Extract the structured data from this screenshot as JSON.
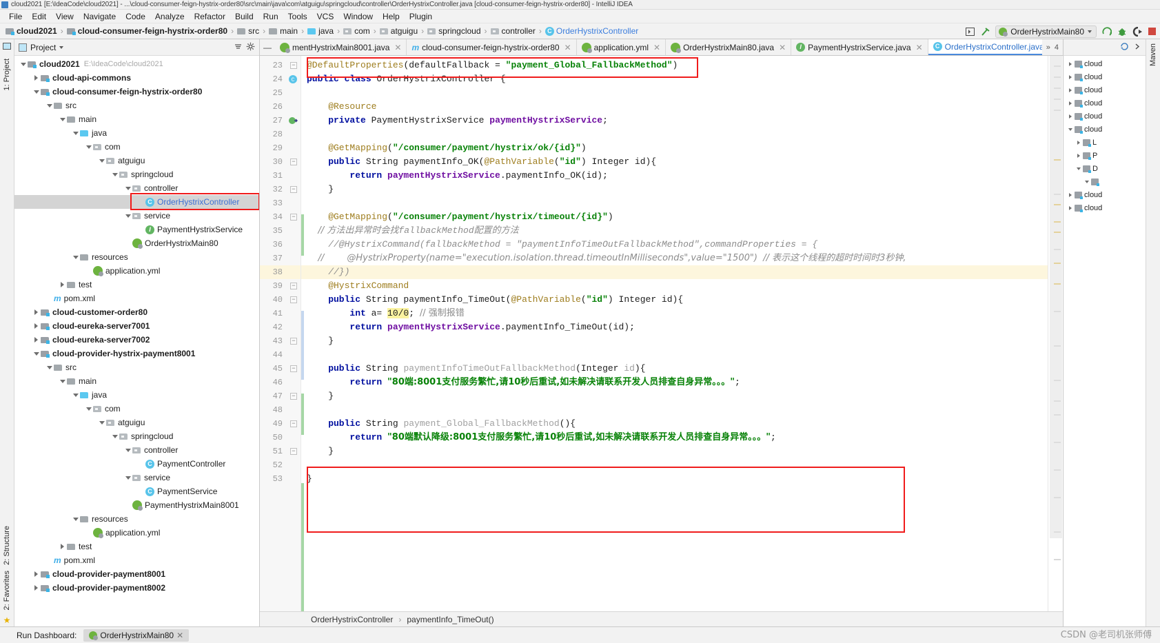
{
  "window": {
    "title": "cloud2021 [E:\\IdeaCode\\cloud2021] - ...\\cloud-consumer-feign-hystrix-order80\\src\\main\\java\\com\\atguigu\\springcloud\\controller\\OrderHystrixController.java [cloud-consumer-feign-hystrix-order80] - IntelliJ IDEA"
  },
  "menubar": {
    "items": [
      "File",
      "Edit",
      "View",
      "Navigate",
      "Code",
      "Analyze",
      "Refactor",
      "Build",
      "Run",
      "Tools",
      "VCS",
      "Window",
      "Help",
      "Plugin"
    ]
  },
  "breadcrumb": {
    "items": [
      {
        "label": "cloud2021",
        "icon": "module-icon",
        "bold": true,
        "type": "module"
      },
      {
        "label": "cloud-consumer-feign-hystrix-order80",
        "icon": "module-icon",
        "bold": true,
        "type": "module"
      },
      {
        "label": "src",
        "icon": "folder-icon",
        "bold": false,
        "type": "folder"
      },
      {
        "label": "main",
        "icon": "folder-icon",
        "bold": false,
        "type": "folder"
      },
      {
        "label": "java",
        "icon": "source-folder-icon",
        "bold": false,
        "type": "folderblue"
      },
      {
        "label": "com",
        "icon": "package-icon",
        "bold": false,
        "type": "pkg"
      },
      {
        "label": "atguigu",
        "icon": "package-icon",
        "bold": false,
        "type": "pkg"
      },
      {
        "label": "springcloud",
        "icon": "package-icon",
        "bold": false,
        "type": "pkg"
      },
      {
        "label": "controller",
        "icon": "package-icon",
        "bold": false,
        "type": "pkg"
      },
      {
        "label": "OrderHystrixController",
        "icon": "class-icon",
        "bold": false,
        "type": "class",
        "highlight": true
      }
    ]
  },
  "toolbar": {
    "run_configuration": "OrderHystrixMain80",
    "maven_label": "Maven"
  },
  "project_panel": {
    "title": "Project",
    "tree": [
      {
        "indent": 0,
        "twist": "down",
        "icon": "module-icon",
        "label": "cloud2021",
        "bold": true,
        "path": "E:\\IdeaCode\\cloud2021"
      },
      {
        "indent": 1,
        "twist": "right",
        "icon": "module-icon",
        "label": "cloud-api-commons",
        "bold": true
      },
      {
        "indent": 1,
        "twist": "down",
        "icon": "module-icon",
        "label": "cloud-consumer-feign-hystrix-order80",
        "bold": true
      },
      {
        "indent": 2,
        "twist": "down",
        "icon": "folder-icon",
        "label": "src"
      },
      {
        "indent": 3,
        "twist": "down",
        "icon": "folder-icon",
        "label": "main"
      },
      {
        "indent": 4,
        "twist": "down",
        "icon": "source-folder-icon",
        "label": "java"
      },
      {
        "indent": 5,
        "twist": "down",
        "icon": "package-icon",
        "label": "com"
      },
      {
        "indent": 6,
        "twist": "down",
        "icon": "package-icon",
        "label": "atguigu"
      },
      {
        "indent": 7,
        "twist": "down",
        "icon": "package-icon",
        "label": "springcloud"
      },
      {
        "indent": 8,
        "twist": "down",
        "icon": "package-icon",
        "label": "controller"
      },
      {
        "indent": 9,
        "twist": "none",
        "icon": "class-icon",
        "label": "OrderHystrixController",
        "selected": true,
        "blue": true
      },
      {
        "indent": 8,
        "twist": "down",
        "icon": "package-icon",
        "label": "service"
      },
      {
        "indent": 9,
        "twist": "none",
        "icon": "interface-icon",
        "label": "PaymentHystrixService"
      },
      {
        "indent": 8,
        "twist": "none",
        "icon": "spring-boot-icon",
        "label": "OrderHystrixMain80"
      },
      {
        "indent": 4,
        "twist": "down",
        "icon": "resources-folder-icon",
        "label": "resources"
      },
      {
        "indent": 5,
        "twist": "none",
        "icon": "yaml-icon",
        "label": "application.yml"
      },
      {
        "indent": 3,
        "twist": "right",
        "icon": "folder-icon",
        "label": "test"
      },
      {
        "indent": 2,
        "twist": "none",
        "icon": "maven-icon",
        "label": "pom.xml"
      },
      {
        "indent": 1,
        "twist": "right",
        "icon": "module-icon",
        "label": "cloud-customer-order80",
        "bold": true
      },
      {
        "indent": 1,
        "twist": "right",
        "icon": "module-icon",
        "label": "cloud-eureka-server7001",
        "bold": true
      },
      {
        "indent": 1,
        "twist": "right",
        "icon": "module-icon",
        "label": "cloud-eureka-server7002",
        "bold": true
      },
      {
        "indent": 1,
        "twist": "down",
        "icon": "module-icon",
        "label": "cloud-provider-hystrix-payment8001",
        "bold": true
      },
      {
        "indent": 2,
        "twist": "down",
        "icon": "folder-icon",
        "label": "src"
      },
      {
        "indent": 3,
        "twist": "down",
        "icon": "folder-icon",
        "label": "main"
      },
      {
        "indent": 4,
        "twist": "down",
        "icon": "source-folder-icon",
        "label": "java"
      },
      {
        "indent": 5,
        "twist": "down",
        "icon": "package-icon",
        "label": "com"
      },
      {
        "indent": 6,
        "twist": "down",
        "icon": "package-icon",
        "label": "atguigu"
      },
      {
        "indent": 7,
        "twist": "down",
        "icon": "package-icon",
        "label": "springcloud"
      },
      {
        "indent": 8,
        "twist": "down",
        "icon": "package-icon",
        "label": "controller"
      },
      {
        "indent": 9,
        "twist": "none",
        "icon": "class-icon",
        "label": "PaymentController"
      },
      {
        "indent": 8,
        "twist": "down",
        "icon": "package-icon",
        "label": "service"
      },
      {
        "indent": 9,
        "twist": "none",
        "icon": "class-icon",
        "label": "PaymentService"
      },
      {
        "indent": 8,
        "twist": "none",
        "icon": "spring-boot-icon",
        "label": "PaymentHystrixMain8001"
      },
      {
        "indent": 4,
        "twist": "down",
        "icon": "resources-folder-icon",
        "label": "resources"
      },
      {
        "indent": 5,
        "twist": "none",
        "icon": "yaml-icon",
        "label": "application.yml"
      },
      {
        "indent": 3,
        "twist": "right",
        "icon": "folder-icon",
        "label": "test"
      },
      {
        "indent": 2,
        "twist": "none",
        "icon": "maven-icon",
        "label": "pom.xml"
      },
      {
        "indent": 1,
        "twist": "right",
        "icon": "module-icon",
        "label": "cloud-provider-payment8001",
        "bold": true
      },
      {
        "indent": 1,
        "twist": "right",
        "icon": "module-icon",
        "label": "cloud-provider-payment8002",
        "bold": true
      }
    ]
  },
  "editor_tabs": [
    {
      "label": "mentHystrixMain8001.java",
      "icon": "spring-boot-icon",
      "active": false,
      "truncated": true
    },
    {
      "label": "cloud-consumer-feign-hystrix-order80",
      "icon": "maven-icon",
      "active": false
    },
    {
      "label": "application.yml",
      "icon": "yaml-icon",
      "active": false
    },
    {
      "label": "OrderHystrixMain80.java",
      "icon": "spring-boot-icon",
      "active": false
    },
    {
      "label": "PaymentHystrixService.java",
      "icon": "interface-icon",
      "active": false
    },
    {
      "label": "OrderHystrixController.java",
      "icon": "class-icon",
      "active": true
    }
  ],
  "editor_tabs_overflow": "4",
  "code": {
    "first_line_number": 23,
    "lines": [
      {
        "n": 23,
        "fold": "minus",
        "segs": [
          {
            "t": "@DefaultProperties",
            "c": "ann"
          },
          {
            "t": "(defaultFallback = ",
            "c": "plain"
          },
          {
            "t": "\"payment_Global_FallbackMethod\"",
            "c": "str"
          },
          {
            "t": ")",
            "c": "plain"
          }
        ]
      },
      {
        "n": 24,
        "mark": "class",
        "segs": [
          {
            "t": "public class ",
            "c": "kw"
          },
          {
            "t": "OrderHystrixController ",
            "c": "plain"
          },
          {
            "t": "{",
            "c": "plain"
          }
        ]
      },
      {
        "n": 25,
        "segs": []
      },
      {
        "n": 26,
        "segs": [
          {
            "t": "    @Resource",
            "c": "ann"
          }
        ]
      },
      {
        "n": 27,
        "mark": "impl",
        "segs": [
          {
            "t": "    private ",
            "c": "kw"
          },
          {
            "t": "PaymentHystrixService ",
            "c": "plain"
          },
          {
            "t": "paymentHystrixService",
            "c": "fld"
          },
          {
            "t": ";",
            "c": "plain"
          }
        ]
      },
      {
        "n": 28,
        "segs": []
      },
      {
        "n": 29,
        "segs": [
          {
            "t": "    @GetMapping",
            "c": "ann"
          },
          {
            "t": "(",
            "c": "plain"
          },
          {
            "t": "\"/consumer/payment/hystrix/ok/{id}\"",
            "c": "str"
          },
          {
            "t": ")",
            "c": "plain"
          }
        ]
      },
      {
        "n": 30,
        "fold": "minus",
        "segs": [
          {
            "t": "    public ",
            "c": "kw"
          },
          {
            "t": "String paymentInfo_OK(",
            "c": "plain"
          },
          {
            "t": "@PathVariable",
            "c": "ann"
          },
          {
            "t": "(",
            "c": "plain"
          },
          {
            "t": "\"id\"",
            "c": "str"
          },
          {
            "t": ") Integer id){",
            "c": "plain"
          }
        ]
      },
      {
        "n": 31,
        "segs": [
          {
            "t": "        return ",
            "c": "kw"
          },
          {
            "t": "paymentHystrixService",
            "c": "fld"
          },
          {
            "t": ".paymentInfo_OK(id);",
            "c": "plain"
          }
        ]
      },
      {
        "n": 32,
        "fold": "minus",
        "segs": [
          {
            "t": "    }",
            "c": "plain"
          }
        ]
      },
      {
        "n": 33,
        "segs": []
      },
      {
        "n": 34,
        "fold": "minus",
        "segs": [
          {
            "t": "    @GetMapping",
            "c": "ann"
          },
          {
            "t": "(",
            "c": "plain"
          },
          {
            "t": "\"/consumer/payment/hystrix/timeout/{id}\"",
            "c": "str"
          },
          {
            "t": ")",
            "c": "plain"
          }
        ]
      },
      {
        "n": 35,
        "segs": [
          {
            "t": "    // 方法出异常时会找",
            "c": "cmt"
          },
          {
            "t": "fallbackMethod",
            "c": "cmt"
          },
          {
            "t": "配置的方法",
            "c": "cmt"
          }
        ]
      },
      {
        "n": 36,
        "segs": [
          {
            "t": "    //@HystrixCommand(fallbackMethod = \"paymentInfoTimeOutFallbackMethod\",commandProperties = {",
            "c": "cmt"
          }
        ]
      },
      {
        "n": 37,
        "segs": [
          {
            "t": "    //        @HystrixProperty(name=\"execution.isolation.thread.timeoutInMilliseconds\",value=\"1500\")  // 表示这个线程的超时时间时3秒钟,",
            "c": "cmt"
          }
        ]
      },
      {
        "n": 38,
        "hl": true,
        "segs": [
          {
            "t": "    //})",
            "c": "cmt"
          }
        ]
      },
      {
        "n": 39,
        "fold": "minus",
        "segs": [
          {
            "t": "    @HystrixCommand",
            "c": "ann"
          }
        ]
      },
      {
        "n": 40,
        "fold": "minus",
        "segs": [
          {
            "t": "    public ",
            "c": "kw"
          },
          {
            "t": "String paymentInfo_TimeOut(",
            "c": "plain"
          },
          {
            "t": "@PathVariable",
            "c": "ann"
          },
          {
            "t": "(",
            "c": "plain"
          },
          {
            "t": "\"id\"",
            "c": "str"
          },
          {
            "t": ") Integer id){",
            "c": "plain"
          }
        ]
      },
      {
        "n": 41,
        "segs": [
          {
            "t": "        int ",
            "c": "kw"
          },
          {
            "t": "a= ",
            "c": "plain"
          },
          {
            "t": "10/0",
            "c": "num"
          },
          {
            "t": "; ",
            "c": "plain"
          },
          {
            "t": "// 强制报错",
            "c": "cmt2"
          }
        ]
      },
      {
        "n": 42,
        "segs": [
          {
            "t": "        return ",
            "c": "kw"
          },
          {
            "t": "paymentHystrixService",
            "c": "fld"
          },
          {
            "t": ".paymentInfo_TimeOut(id);",
            "c": "plain"
          }
        ]
      },
      {
        "n": 43,
        "fold": "minus",
        "segs": [
          {
            "t": "    }",
            "c": "plain"
          }
        ]
      },
      {
        "n": 44,
        "segs": []
      },
      {
        "n": 45,
        "fold": "minus",
        "segs": [
          {
            "t": "    public ",
            "c": "kw"
          },
          {
            "t": "String ",
            "c": "plain"
          },
          {
            "t": "paymentInfoTimeOutFallbackMethod",
            "c": "grey"
          },
          {
            "t": "(Integer ",
            "c": "plain"
          },
          {
            "t": "id",
            "c": "grey"
          },
          {
            "t": "){",
            "c": "plain"
          }
        ]
      },
      {
        "n": 46,
        "segs": [
          {
            "t": "        return ",
            "c": "kw"
          },
          {
            "t": "\"80端:8001支付服务繁忙,请10秒后重试,如未解决请联系开发人员排查自身异常。。。\"",
            "c": "str"
          },
          {
            "t": ";",
            "c": "plain"
          }
        ]
      },
      {
        "n": 47,
        "fold": "minus",
        "segs": [
          {
            "t": "    }",
            "c": "plain"
          }
        ]
      },
      {
        "n": 48,
        "segs": []
      },
      {
        "n": 49,
        "fold": "minus",
        "segs": [
          {
            "t": "    public ",
            "c": "kw"
          },
          {
            "t": "String ",
            "c": "plain"
          },
          {
            "t": "payment_Global_FallbackMethod",
            "c": "grey"
          },
          {
            "t": "(){",
            "c": "plain"
          }
        ]
      },
      {
        "n": 50,
        "segs": [
          {
            "t": "        return ",
            "c": "kw"
          },
          {
            "t": "\"80端默认降级:8001支付服务繁忙,请10秒后重试,如未解决请联系开发人员排查自身异常。。。\"",
            "c": "str"
          },
          {
            "t": ";",
            "c": "plain"
          }
        ]
      },
      {
        "n": 51,
        "fold": "minus",
        "segs": [
          {
            "t": "    }",
            "c": "plain"
          }
        ]
      },
      {
        "n": 52,
        "segs": []
      },
      {
        "n": 53,
        "segs": [
          {
            "t": "}",
            "c": "plain"
          }
        ]
      }
    ]
  },
  "editor_breadcrumb": {
    "items": [
      "OrderHystrixController",
      "paymentInfo_TimeOut()"
    ]
  },
  "right_panel": {
    "title": "Maven",
    "rows": [
      {
        "indent": 0,
        "twist": "right",
        "label": "cloud"
      },
      {
        "indent": 0,
        "twist": "right",
        "label": "cloud"
      },
      {
        "indent": 0,
        "twist": "right",
        "label": "cloud"
      },
      {
        "indent": 0,
        "twist": "right",
        "label": "cloud"
      },
      {
        "indent": 0,
        "twist": "right",
        "label": "cloud"
      },
      {
        "indent": 0,
        "twist": "down",
        "label": "cloud"
      },
      {
        "indent": 1,
        "twist": "right",
        "label": "L"
      },
      {
        "indent": 1,
        "twist": "right",
        "label": "P"
      },
      {
        "indent": 1,
        "twist": "down",
        "label": "D"
      },
      {
        "indent": 2,
        "twist": "down",
        "label": ""
      },
      {
        "indent": 0,
        "twist": "right",
        "label": "cloud"
      },
      {
        "indent": 0,
        "twist": "right",
        "label": "cloud"
      }
    ]
  },
  "left_rail": {
    "top_items": [
      "1: Project"
    ],
    "bottom_items": [
      "2: Structure",
      "2: Favorites"
    ]
  },
  "bottom_bar": {
    "label": "Run Dashboard:",
    "tab": "OrderHystrixMain80"
  },
  "watermark": "CSDN @老司机张师傅",
  "colors": {
    "accent": "#4a89dc",
    "annotation_red": "#f01b1b",
    "keyword_blue": "#000f9f",
    "string_green": "#088208",
    "annotation_gold": "#9e7d1e",
    "field_purple": "#6f0ea1",
    "highlight_yellow": "#fdf6dd",
    "selection_grey": "#d4d4d4",
    "spring_green": "#6db33f",
    "class_blue": "#58c4ea"
  }
}
